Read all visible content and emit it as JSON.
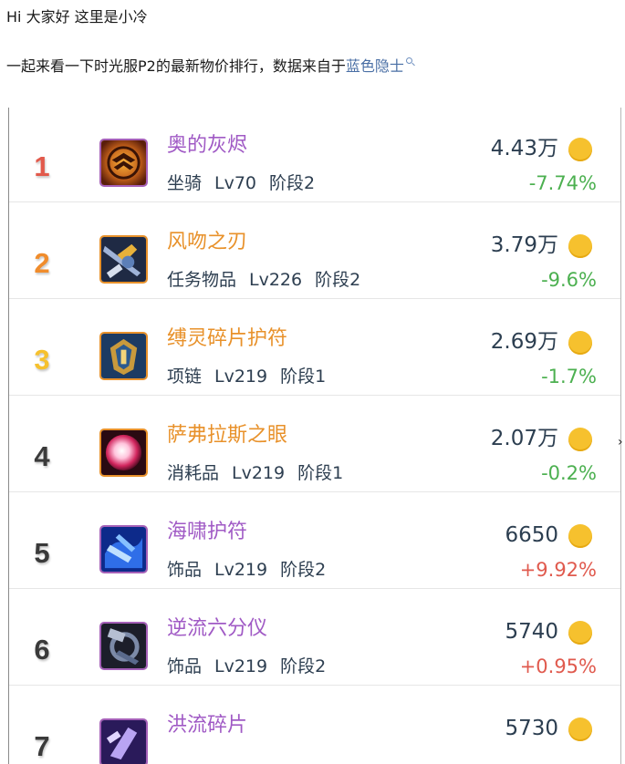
{
  "intro": {
    "greeting": "Hi 大家好 这里是小冷",
    "line_prefix": "一起来看一下时光服P2的最新物价排行，数据来自于",
    "source_link": "蓝色隐士"
  },
  "colors": {
    "purple": "#a05ac5",
    "orange": "#e8912a",
    "green": "#4cb050",
    "red": "#e05a4e",
    "rank1": "#e25a4c",
    "rank2": "#f08c2c",
    "rank3": "#f6c12e",
    "rank_default": "#3a3a3a",
    "coin": "#f6c12e"
  },
  "items": [
    {
      "rank": "1",
      "name": "奥的灰烬",
      "name_color": "#a05ac5",
      "type": "坐骑",
      "level": "Lv70",
      "stage": "阶段2",
      "price": "4.43万",
      "change": "-7.74%",
      "change_color": "#4cb050",
      "rank_color": "#e25a4c",
      "icon": "ashes-of-alar-icon",
      "border": "#a560b8"
    },
    {
      "rank": "2",
      "name": "风吻之刃",
      "name_color": "#e8912a",
      "type": "任务物品",
      "level": "Lv226",
      "stage": "阶段2",
      "price": "3.79万",
      "change": "-9.6%",
      "change_color": "#4cb050",
      "rank_color": "#f08c2c",
      "icon": "windkiss-blade-icon",
      "border": "#e8912a"
    },
    {
      "rank": "3",
      "name": "缚灵碎片护符",
      "name_color": "#e8912a",
      "type": "项链",
      "level": "Lv219",
      "stage": "阶段1",
      "price": "2.69万",
      "change": "-1.7%",
      "change_color": "#4cb050",
      "rank_color": "#f6c12e",
      "icon": "amulet-icon",
      "border": "#e8912a"
    },
    {
      "rank": "4",
      "name": "萨弗拉斯之眼",
      "name_color": "#e8912a",
      "type": "消耗品",
      "level": "Lv219",
      "stage": "阶段1",
      "price": "2.07万",
      "change": "-0.2%",
      "change_color": "#4cb050",
      "rank_color": "#3a3a3a",
      "icon": "eye-orb-icon",
      "border": "#e8912a"
    },
    {
      "rank": "5",
      "name": "海啸护符",
      "name_color": "#a05ac5",
      "type": "饰品",
      "level": "Lv219",
      "stage": "阶段2",
      "price": "6650",
      "change": "+9.92%",
      "change_color": "#e05a4e",
      "rank_color": "#3a3a3a",
      "icon": "tsunami-talisman-icon",
      "border": "#a560b8"
    },
    {
      "rank": "6",
      "name": "逆流六分仪",
      "name_color": "#a05ac5",
      "type": "饰品",
      "level": "Lv219",
      "stage": "阶段2",
      "price": "5740",
      "change": "+0.95%",
      "change_color": "#e05a4e",
      "rank_color": "#3a3a3a",
      "icon": "sextant-icon",
      "border": "#a560b8"
    },
    {
      "rank": "7",
      "name": "洪流碎片",
      "name_color": "#a05ac5",
      "type": "",
      "level": "",
      "stage": "",
      "price": "5730",
      "change": "",
      "change_color": "#e05a4e",
      "rank_color": "#3a3a3a",
      "icon": "torrent-shard-icon",
      "border": "#a560b8"
    }
  ]
}
